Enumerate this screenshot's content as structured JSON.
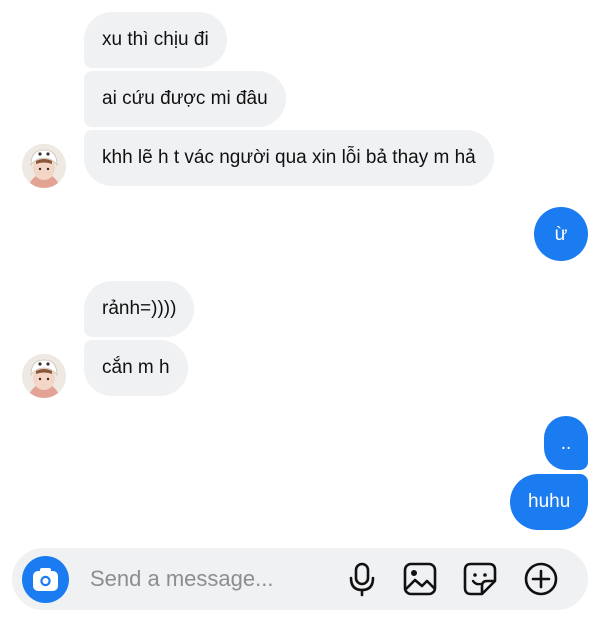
{
  "messages": [
    {
      "side": "incoming",
      "text": "xu thì chịu đi"
    },
    {
      "side": "incoming",
      "text": "ai cứu được mi đâu"
    },
    {
      "side": "incoming",
      "text": "khh lẽ h t vác người qua xin lỗi bả thay m hả"
    },
    {
      "side": "outgoing",
      "text": "ừ"
    },
    {
      "side": "incoming",
      "text": "rảnh=))))"
    },
    {
      "side": "incoming",
      "text": "cắn m h"
    },
    {
      "side": "outgoing",
      "text": ".."
    },
    {
      "side": "outgoing",
      "text": "huhu"
    }
  ],
  "composer": {
    "placeholder": "Send a message...",
    "icons": [
      "camera-icon",
      "microphone-icon",
      "image-icon",
      "sticker-icon",
      "plus-icon"
    ]
  },
  "colors": {
    "outgoing_bubble": "#1a7cf0",
    "incoming_bubble": "#f0f1f3",
    "composer_bg": "#f0f1f3",
    "placeholder": "#8a8d91"
  }
}
